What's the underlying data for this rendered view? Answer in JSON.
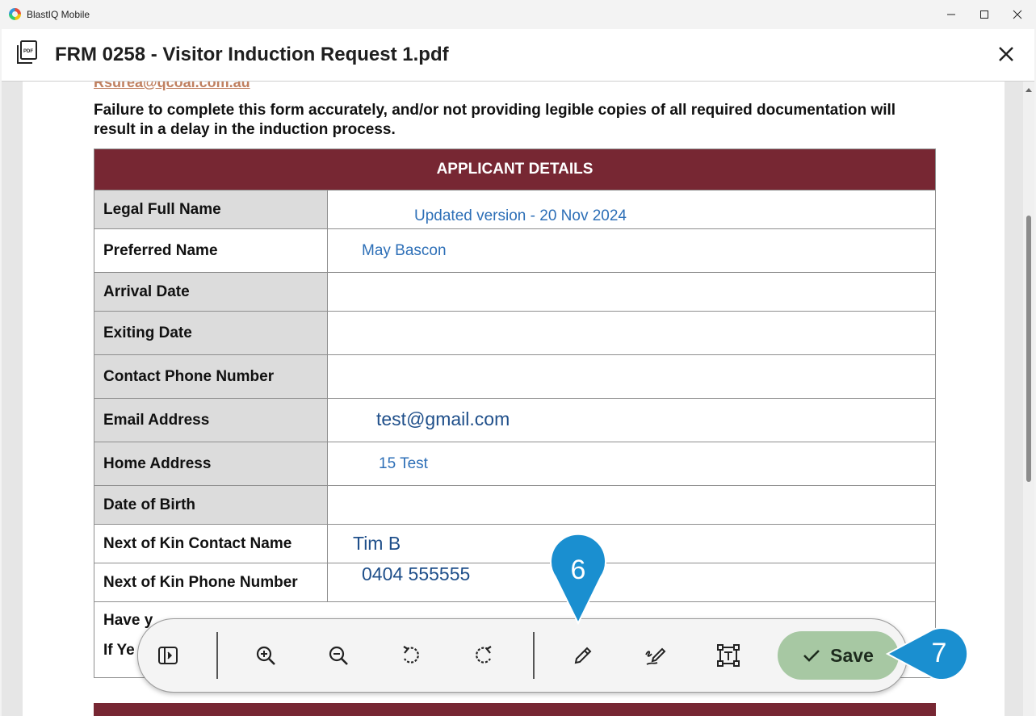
{
  "window": {
    "app_title": "BlastIQ Mobile",
    "minimize": "—",
    "maximize": "☐",
    "close": "✕"
  },
  "header": {
    "doc_title": "FRM 0258 - Visitor Induction Request 1.pdf",
    "close": "✕"
  },
  "document": {
    "partial_email": "Rsurea@qcoal.com.au",
    "notice": "Failure to complete this form accurately, and/or not providing legible copies of all required documentation will result in a delay in the induction process.",
    "section_title": "APPLICANT DETAILS",
    "rows": [
      {
        "label": "Legal Full Name",
        "value": "Updated version - 20 Nov 2024"
      },
      {
        "label": "Preferred Name",
        "value": "May Bascon"
      },
      {
        "label": "Arrival Date",
        "value": ""
      },
      {
        "label": "Exiting Date",
        "value": ""
      },
      {
        "label": "Contact Phone Number",
        "value": ""
      },
      {
        "label": "Email Address",
        "value": "test@gmail.com"
      },
      {
        "label": "Home Address",
        "value": "15 Test"
      },
      {
        "label": "Date of Birth",
        "value": ""
      },
      {
        "label": "Next of Kin Contact Name",
        "value": "Tim B"
      },
      {
        "label": "Next of Kin Phone Number",
        "value": "0404 555555"
      }
    ],
    "partial_row_line1": "Have y",
    "partial_row_line2": "If Ye"
  },
  "toolbar": {
    "save_label": "Save",
    "icons": [
      "sidebar-toggle-icon",
      "zoom-in-icon",
      "zoom-out-icon",
      "rotate-left-icon",
      "rotate-right-icon",
      "pen-icon",
      "signature-icon",
      "text-box-icon",
      "check-icon"
    ]
  },
  "callouts": {
    "step6": "6",
    "step7": "7",
    "color": "#1a8fd0"
  }
}
